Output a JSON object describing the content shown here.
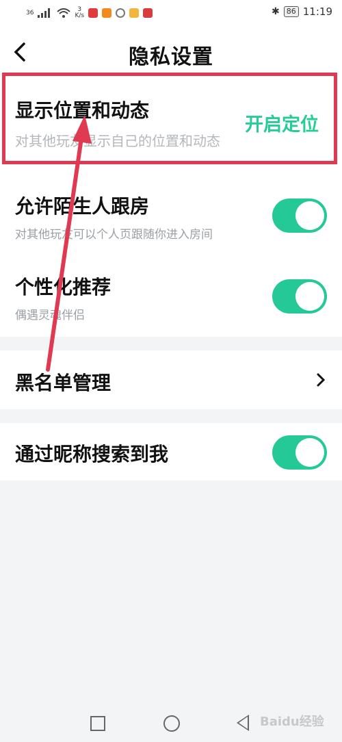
{
  "status_bar": {
    "signal": "36",
    "speed_value": "3",
    "speed_unit": "K/s",
    "battery": "86",
    "time": "11:19"
  },
  "header": {
    "back_label": "‹",
    "title": "隐私设置"
  },
  "settings": [
    {
      "title": "显示位置和动态",
      "subtitle": "对其他玩友显示自己的位置和动态"
    },
    {
      "title": "允许陌生人跟房",
      "subtitle": "对其他玩友可以个人页跟随你进入房间",
      "enabled": true
    },
    {
      "title": "个性化推荐",
      "subtitle": "偶遇灵魂伴侣",
      "enabled": true
    },
    {
      "title": "黑名单管理"
    },
    {
      "title": "通过昵称搜索到我",
      "enabled": true
    }
  ],
  "annotation": "开启定位",
  "watermark": "Baidu经验",
  "colors": {
    "accent": "#24c997",
    "highlight": "#e03a52",
    "annotation": "#26cc95"
  }
}
